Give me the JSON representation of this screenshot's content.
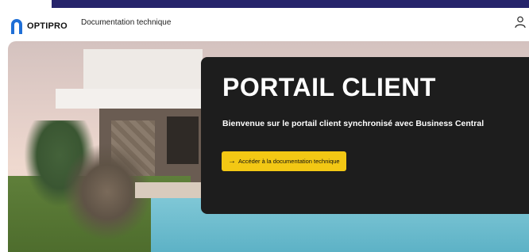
{
  "header": {
    "logo_text": "OPTIPRO",
    "nav_link": "Documentation technique",
    "user_icon": "user-icon",
    "accent_color": "#26246b"
  },
  "hero": {
    "title": "PORTAIL CLIENT",
    "subtitle": "Bienvenue sur le portail client synchronisé avec Business Central",
    "cta_label": "Accéder à la documentation technique",
    "cta_icon": "arrow-right-icon",
    "cta_color": "#f3c814",
    "panel_color": "#1d1d1d"
  }
}
